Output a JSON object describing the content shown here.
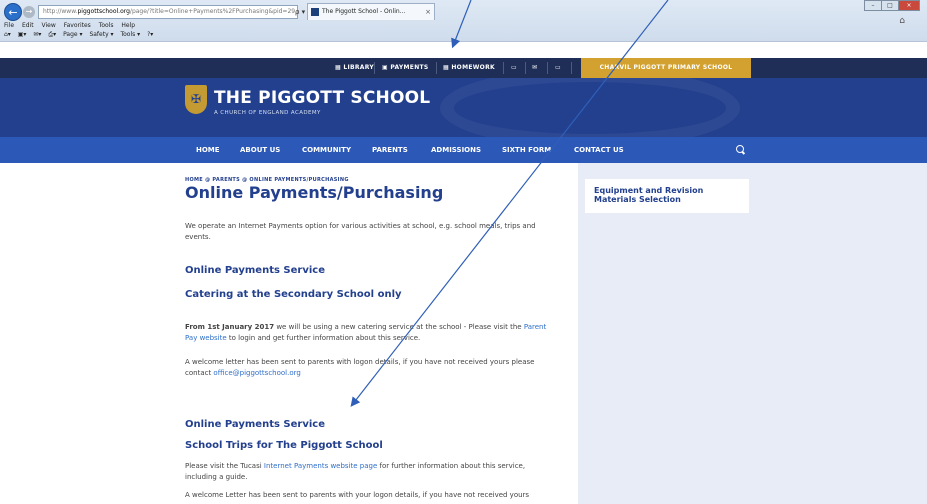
{
  "browser": {
    "address_prefix": "http://www.",
    "address_domain": "piggottschool.org",
    "address_suffix": "/page/?title=Online+Payments%2FPurchasing&pid=29",
    "address_buttons": "ρ ▾ C",
    "tab_title": "The Piggott School - Onlin...",
    "tab_close": "×",
    "menu": [
      "File",
      "Edit",
      "View",
      "Favorites",
      "Tools",
      "Help"
    ],
    "commands": [
      "Page ▾",
      "Safety ▾",
      "Tools ▾"
    ]
  },
  "utility": {
    "items": [
      {
        "label": "LIBRARY"
      },
      {
        "label": "PAYMENTS"
      },
      {
        "label": "HOMEWORK"
      }
    ],
    "primary_school": "CHARVIL PIGGOTT PRIMARY SCHOOL"
  },
  "header": {
    "school_name": "THE PIGGOTT SCHOOL",
    "subtitle": "A CHURCH OF ENGLAND ACADEMY"
  },
  "nav": {
    "items": [
      "HOME",
      "ABOUT US",
      "COMMUNITY",
      "PARENTS",
      "ADMISSIONS",
      "SIXTH FORM",
      "CONTACT US"
    ]
  },
  "page": {
    "breadcrumb": "HOME @ PARENTS @ ONLINE PAYMENTS/PURCHASING",
    "title": "Online Payments/Purchasing",
    "intro": "We operate an Internet Payments option for various activities at school, e.g. school meals, trips and events.",
    "section1_heading": "Online Payments Service",
    "section1_sub": "Catering at the Secondary School only",
    "section1_p1_bold": "From 1st January 2017",
    "section1_p1_text": " we will be using a new catering service at the school - Please visit the ",
    "section1_p1_link": "Parent Pay website",
    "section1_p1_end": " to login and get further information about this service.",
    "section1_p2": "A welcome letter has been sent to parents with logon details, if you have not received yours please contact ",
    "section1_email": "office@piggottschool.org",
    "section2_heading": "Online Payments Service",
    "section2_sub": "School Trips for The Piggott School",
    "section2_p1_start": "Please visit the Tucasi ",
    "section2_p1_link": "Internet Payments website page",
    "section2_p1_end": " for further information about this service, including a guide.",
    "section2_p2": "A welcome Letter has been sent to parents with your logon details, if you have not received yours"
  },
  "sidebar": {
    "card_title": "Equipment and Revision Materials Selection"
  }
}
